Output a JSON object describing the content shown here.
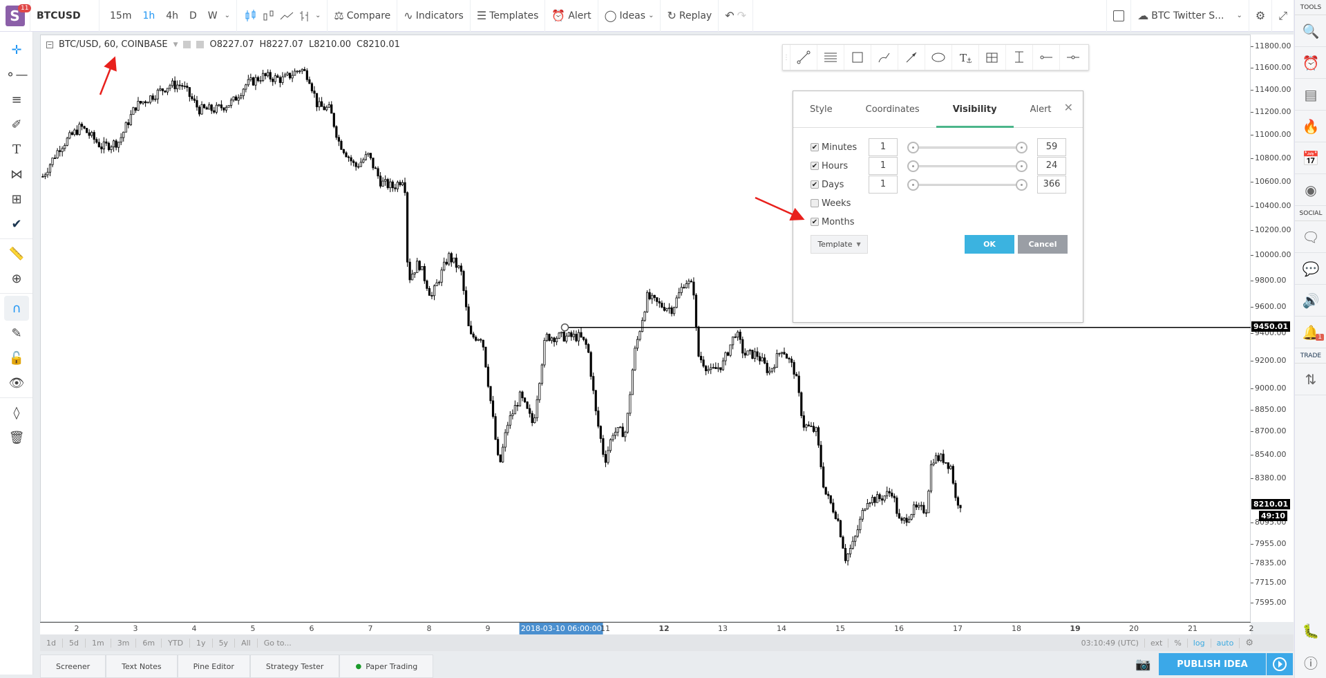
{
  "header": {
    "logo_badge": "11",
    "symbol": "BTCUSD",
    "intervals": [
      "15m",
      "1h",
      "4h",
      "D",
      "W"
    ],
    "active_interval": "1h",
    "compare": "Compare",
    "indicators": "Indicators",
    "templates": "Templates",
    "alert": "Alert",
    "ideas": "Ideas",
    "replay": "Replay",
    "layout_name": "BTC Twitter S...",
    "accent_color": "#2196f3"
  },
  "legend": {
    "title": "BTC/USD, 60, COINBASE",
    "open": "O8227.07",
    "high": "H8227.07",
    "low": "L8210.00",
    "close": "C8210.01"
  },
  "chart_data": {
    "type": "candlestick",
    "interval": "60",
    "yscale": "log",
    "ylim": [
      7560,
      11900
    ],
    "xlim": [
      1.3,
      22.0
    ],
    "x_unit": "day of March 2018",
    "y_ticks": [
      "11800.00",
      "11600.00",
      "11400.00",
      "11200.00",
      "11000.00",
      "10800.00",
      "10600.00",
      "10400.00",
      "10200.00",
      "10000.00",
      "9800.00",
      "9600.00",
      "9400.00",
      "9200.00",
      "9000.00",
      "8850.00",
      "8700.00",
      "8540.00",
      "8380.00",
      "8095.00",
      "7955.00",
      "7835.00",
      "7715.00",
      "7595.00"
    ],
    "x_ticks": [
      {
        "day": 2,
        "label": "2"
      },
      {
        "day": 3,
        "label": "3"
      },
      {
        "day": 4,
        "label": "4"
      },
      {
        "day": 5,
        "label": "5"
      },
      {
        "day": 6,
        "label": "6"
      },
      {
        "day": 7,
        "label": "7"
      },
      {
        "day": 8,
        "label": "8"
      },
      {
        "day": 9,
        "label": "9"
      },
      {
        "day": 11,
        "label": "11"
      },
      {
        "day": 12,
        "label": "12",
        "bold": true
      },
      {
        "day": 13,
        "label": "13"
      },
      {
        "day": 14,
        "label": "14"
      },
      {
        "day": 15,
        "label": "15"
      },
      {
        "day": 16,
        "label": "16"
      },
      {
        "day": 17,
        "label": "17"
      },
      {
        "day": 18,
        "label": "18"
      },
      {
        "day": 19,
        "label": "19",
        "bold": true
      },
      {
        "day": 20,
        "label": "20"
      },
      {
        "day": 21,
        "label": "21"
      },
      {
        "day": 22,
        "label": "2"
      }
    ],
    "crosshair_date": {
      "day": 10.25,
      "label": "2018-03-10 06:00:00"
    },
    "horizontal_line": {
      "price": 9450.01,
      "label": "9450.01",
      "start_day": 10.3
    },
    "last_price": {
      "price": 8210.01,
      "label": "8210.01",
      "countdown": "49:10"
    },
    "close_path": [
      [
        1.41,
        10650
      ],
      [
        1.7,
        10900
      ],
      [
        2.06,
        11080
      ],
      [
        2.42,
        10900
      ],
      [
        2.71,
        10950
      ],
      [
        2.99,
        11260
      ],
      [
        3.21,
        11330
      ],
      [
        3.57,
        11450
      ],
      [
        3.78,
        11450
      ],
      [
        4.07,
        11230
      ],
      [
        4.36,
        11230
      ],
      [
        4.65,
        11300
      ],
      [
        4.86,
        11450
      ],
      [
        5.15,
        11530
      ],
      [
        5.51,
        11500
      ],
      [
        5.8,
        11600
      ],
      [
        5.94,
        11530
      ],
      [
        6.09,
        11260
      ],
      [
        6.3,
        11230
      ],
      [
        6.45,
        10950
      ],
      [
        6.73,
        10730
      ],
      [
        6.95,
        10830
      ],
      [
        7.17,
        10600
      ],
      [
        7.38,
        10560
      ],
      [
        7.57,
        10650
      ],
      [
        7.63,
        9810
      ],
      [
        7.81,
        9950
      ],
      [
        8.03,
        9680
      ],
      [
        8.32,
        10000
      ],
      [
        8.53,
        9880
      ],
      [
        8.68,
        9380
      ],
      [
        8.89,
        9380
      ],
      [
        9.04,
        8900
      ],
      [
        9.18,
        8450
      ],
      [
        9.32,
        8750
      ],
      [
        9.54,
        8950
      ],
      [
        9.76,
        8750
      ],
      [
        9.97,
        9380
      ],
      [
        10.26,
        9380
      ],
      [
        10.55,
        9380
      ],
      [
        10.69,
        9300
      ],
      [
        10.83,
        8820
      ],
      [
        10.98,
        8500
      ],
      [
        11.12,
        8700
      ],
      [
        11.34,
        8700
      ],
      [
        11.48,
        9250
      ],
      [
        11.7,
        9680
      ],
      [
        11.91,
        9620
      ],
      [
        12.13,
        9590
      ],
      [
        12.35,
        9810
      ],
      [
        12.49,
        9750
      ],
      [
        12.56,
        9250
      ],
      [
        12.78,
        9120
      ],
      [
        12.99,
        9180
      ],
      [
        13.21,
        9420
      ],
      [
        13.35,
        9250
      ],
      [
        13.57,
        9250
      ],
      [
        13.78,
        9120
      ],
      [
        14.0,
        9300
      ],
      [
        14.22,
        9120
      ],
      [
        14.36,
        8750
      ],
      [
        14.58,
        8700
      ],
      [
        14.72,
        8300
      ],
      [
        14.94,
        8130
      ],
      [
        15.08,
        7870
      ],
      [
        15.22,
        7970
      ],
      [
        15.44,
        8250
      ],
      [
        15.65,
        8250
      ],
      [
        15.87,
        8300
      ],
      [
        16.01,
        8080
      ],
      [
        16.23,
        8180
      ],
      [
        16.45,
        8180
      ],
      [
        16.55,
        8520
      ],
      [
        16.73,
        8520
      ],
      [
        16.88,
        8460
      ],
      [
        16.95,
        8250
      ],
      [
        17.06,
        8210
      ]
    ]
  },
  "drawing_toolbar": [
    "trend-line",
    "parallel-channel",
    "rectangle",
    "brush",
    "arrow",
    "ellipse",
    "anchored-text",
    "long-position",
    "price-range",
    "horizontal-ray",
    "horizontal-line"
  ],
  "dialog": {
    "tabs": [
      "Style",
      "Coordinates",
      "Visibility",
      "Alert"
    ],
    "active_tab": "Visibility",
    "rows": [
      {
        "label": "Minutes",
        "checked": true,
        "min": "1",
        "max": "59"
      },
      {
        "label": "Hours",
        "checked": true,
        "min": "1",
        "max": "24"
      },
      {
        "label": "Days",
        "checked": true,
        "min": "1",
        "max": "366"
      },
      {
        "label": "Weeks",
        "checked": false
      },
      {
        "label": "Months",
        "checked": true
      }
    ],
    "template": "Template",
    "ok": "OK",
    "cancel": "Cancel"
  },
  "range_bar": {
    "ranges": [
      "1d",
      "5d",
      "1m",
      "3m",
      "6m",
      "YTD",
      "1y",
      "5y",
      "All",
      "Go to..."
    ],
    "time": "03:10:49 (UTC)",
    "ext": "ext",
    "percent": "%",
    "log": "log",
    "auto": "auto"
  },
  "bottom_tabs": [
    "Screener",
    "Text Notes",
    "Pine Editor",
    "Strategy Tester",
    "Paper Trading"
  ],
  "publish": "PUBLISH IDEA",
  "right_sidebar": {
    "tools": "TOOLS",
    "social": "SOCIAL",
    "trade": "TRADE",
    "notification_count": "1"
  }
}
